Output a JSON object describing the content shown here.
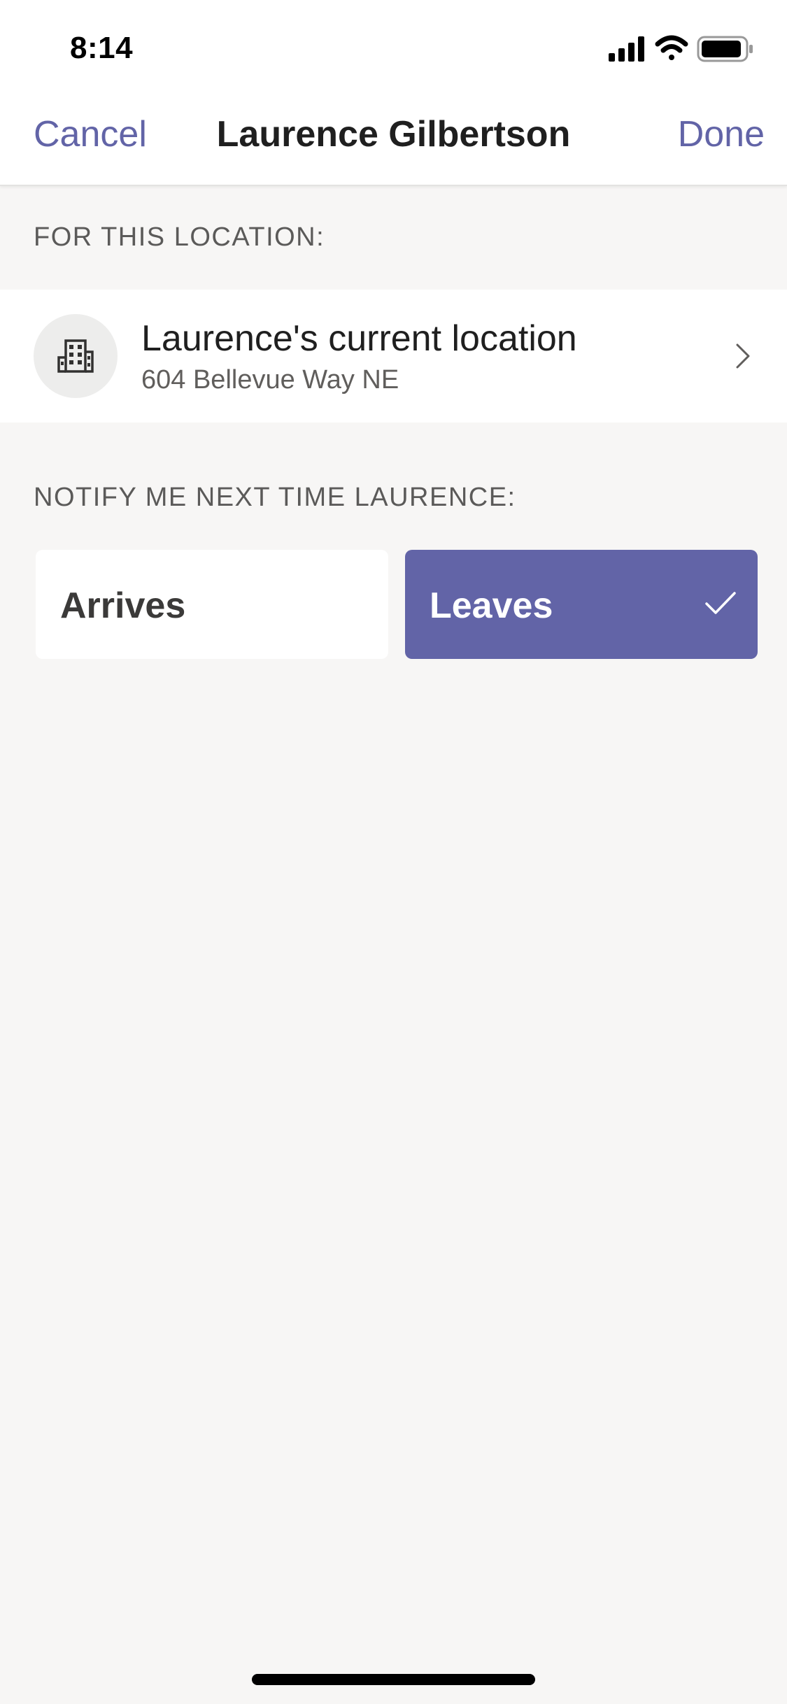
{
  "status_bar": {
    "time": "8:14",
    "icons": [
      "signal-icon",
      "wifi-icon",
      "battery-icon"
    ]
  },
  "nav": {
    "cancel_label": "Cancel",
    "title": "Laurence Gilbertson",
    "done_label": "Done"
  },
  "location_section": {
    "header": "FOR THIS LOCATION:",
    "item": {
      "icon": "building-icon",
      "name": "Laurence's current location",
      "address": "604 Bellevue Way NE"
    }
  },
  "notify_section": {
    "header": "NOTIFY ME NEXT TIME LAURENCE:",
    "options": [
      {
        "label": "Arrives",
        "selected": false
      },
      {
        "label": "Leaves",
        "selected": true
      }
    ]
  },
  "colors": {
    "accent": "#6264a7",
    "background": "#f7f6f5",
    "surface": "#ffffff"
  }
}
